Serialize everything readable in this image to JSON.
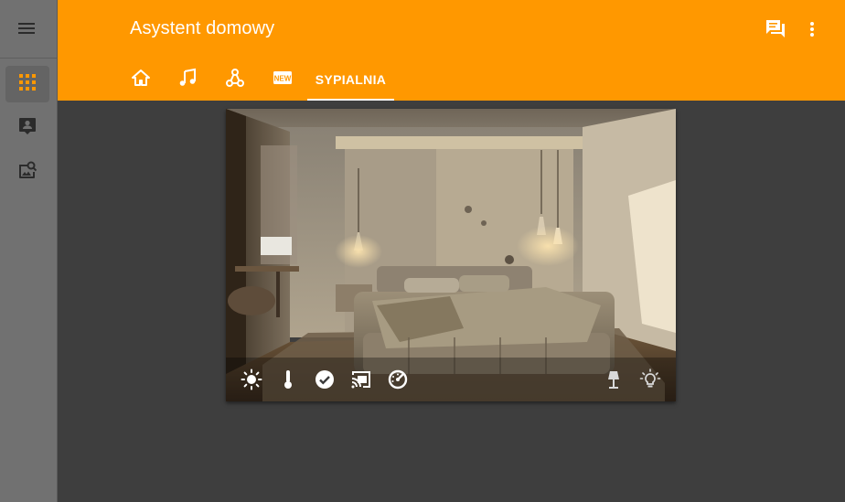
{
  "app": {
    "title": "Asystent domowy"
  },
  "header": {
    "icons": [
      "conversation-icon",
      "more-vertical-icon"
    ]
  },
  "tabs": [
    {
      "icon": "home-icon"
    },
    {
      "icon": "music-note-icon"
    },
    {
      "icon": "network-nodes-icon"
    },
    {
      "icon": "new-badge-icon"
    },
    {
      "label": "SYPIALNIA",
      "active": true
    }
  ],
  "sidebar": {
    "items": [
      {
        "icon": "apps-grid-icon",
        "active": true
      },
      {
        "icon": "account-box-icon",
        "active": false
      },
      {
        "icon": "image-search-icon",
        "active": false
      }
    ]
  },
  "card": {
    "bar_left_icons": [
      "brightness-icon",
      "thermometer-icon",
      "check-circle-icon",
      "cast-connected-icon",
      "speedometer-icon"
    ],
    "bar_right_icons": [
      "floor-lamp-icon",
      "lightbulb-icon"
    ]
  },
  "colors": {
    "accent": "#ff9800",
    "sidebar": "#717171",
    "background": "#3e3e3e"
  }
}
